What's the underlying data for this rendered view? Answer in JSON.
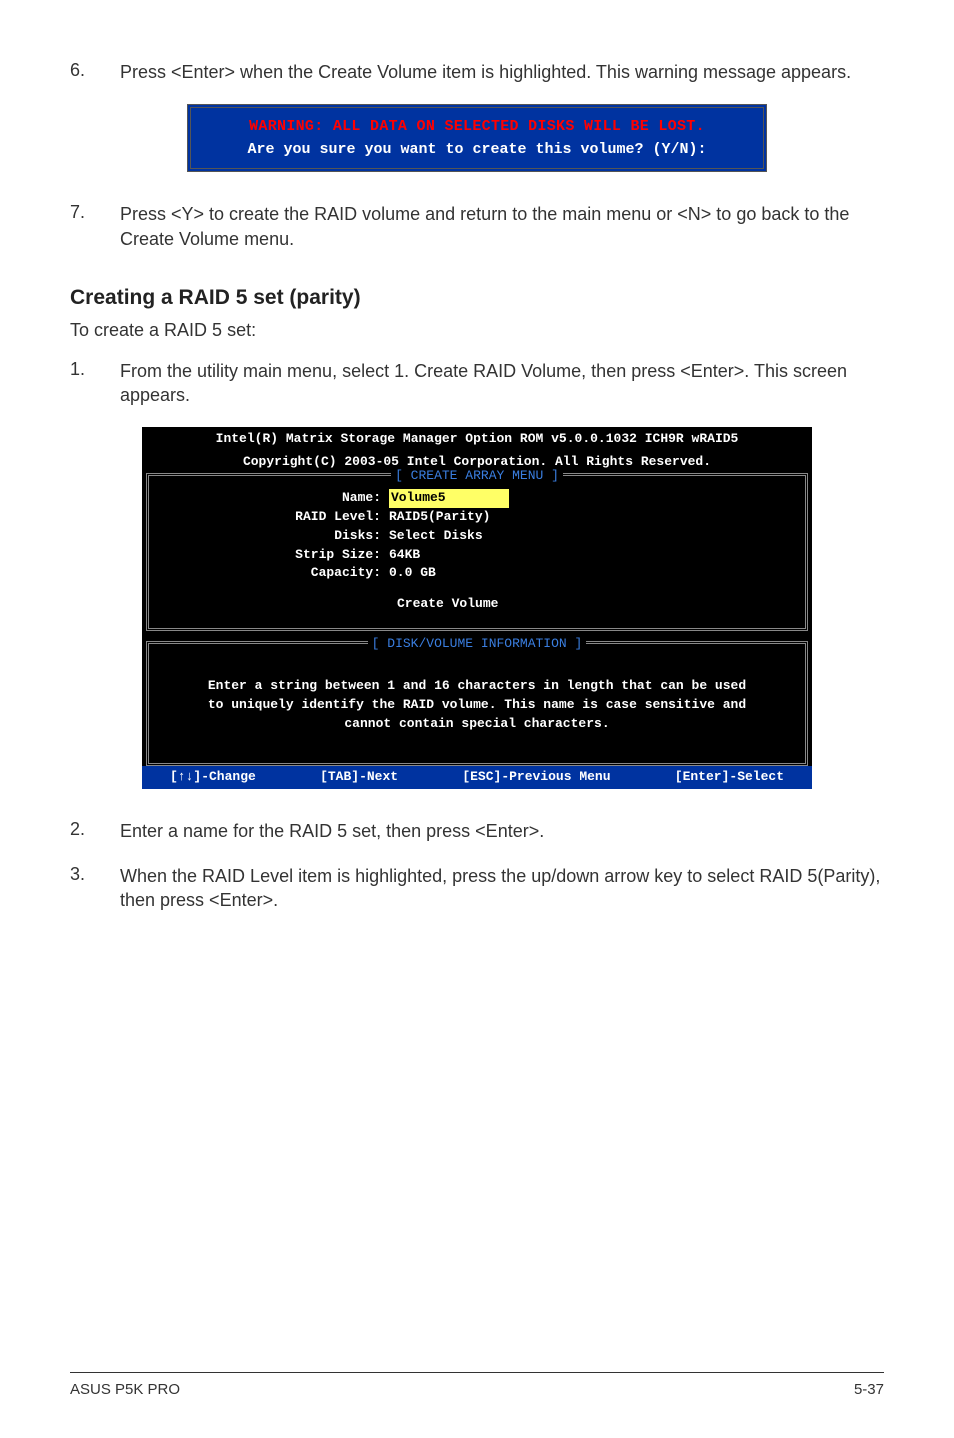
{
  "steps_a": [
    {
      "num": "6.",
      "text": "Press <Enter> when the Create Volume item is highlighted. This warning message appears."
    }
  ],
  "dialog": {
    "warning": "WARNING: ALL DATA ON SELECTED DISKS WILL BE LOST.",
    "prompt": "Are you sure you want to create this volume? (Y/N):"
  },
  "steps_b": [
    {
      "num": "7.",
      "text": "Press <Y> to create the RAID volume and return to the main menu or <N> to go back to the Create Volume menu."
    }
  ],
  "section_heading": "Creating a RAID 5 set (parity)",
  "intro": "To create a RAID 5 set:",
  "steps_c": [
    {
      "num": "1.",
      "text": "From the utility main menu, select 1. Create RAID Volume, then press <Enter>. This screen appears."
    }
  ],
  "bios": {
    "header1": "Intel(R) Matrix Storage Manager Option ROM v5.0.0.1032 ICH9R wRAID5",
    "header2": "Copyright(C) 2003-05 Intel Corporation. All Rights Reserved.",
    "panel1_title": "[ CREATE ARRAY MENU ]",
    "form": {
      "name_label": "Name:",
      "name_value": "Volume5",
      "raid_level_label": "RAID Level:",
      "raid_level_value": "RAID5(Parity)",
      "disks_label": "Disks:",
      "disks_value": "Select Disks",
      "strip_size_label": "Strip Size:",
      "strip_size_value": "64KB",
      "capacity_label": "Capacity:",
      "capacity_value": "0.0  GB"
    },
    "create_volume": "Create Volume",
    "panel2_title": "[ DISK/VOLUME INFORMATION ]",
    "info_line1": "Enter a string between 1 and 16 characters in length that can be used",
    "info_line2": "to uniquely identify the RAID volume. This name is case sensitive and",
    "info_line3": "cannot contain special characters.",
    "footer": {
      "change": "[↑↓]-Change",
      "next": "[TAB]-Next",
      "prev": "[ESC]-Previous Menu",
      "select": "[Enter]-Select"
    }
  },
  "steps_d": [
    {
      "num": "2.",
      "text": "Enter a name for the RAID 5 set, then press <Enter>."
    },
    {
      "num": "3.",
      "text": "When the RAID Level item is highlighted, press the up/down arrow key to select RAID 5(Parity), then press <Enter>."
    }
  ],
  "footer": {
    "left": "ASUS P5K PRO",
    "right": "5-37"
  }
}
